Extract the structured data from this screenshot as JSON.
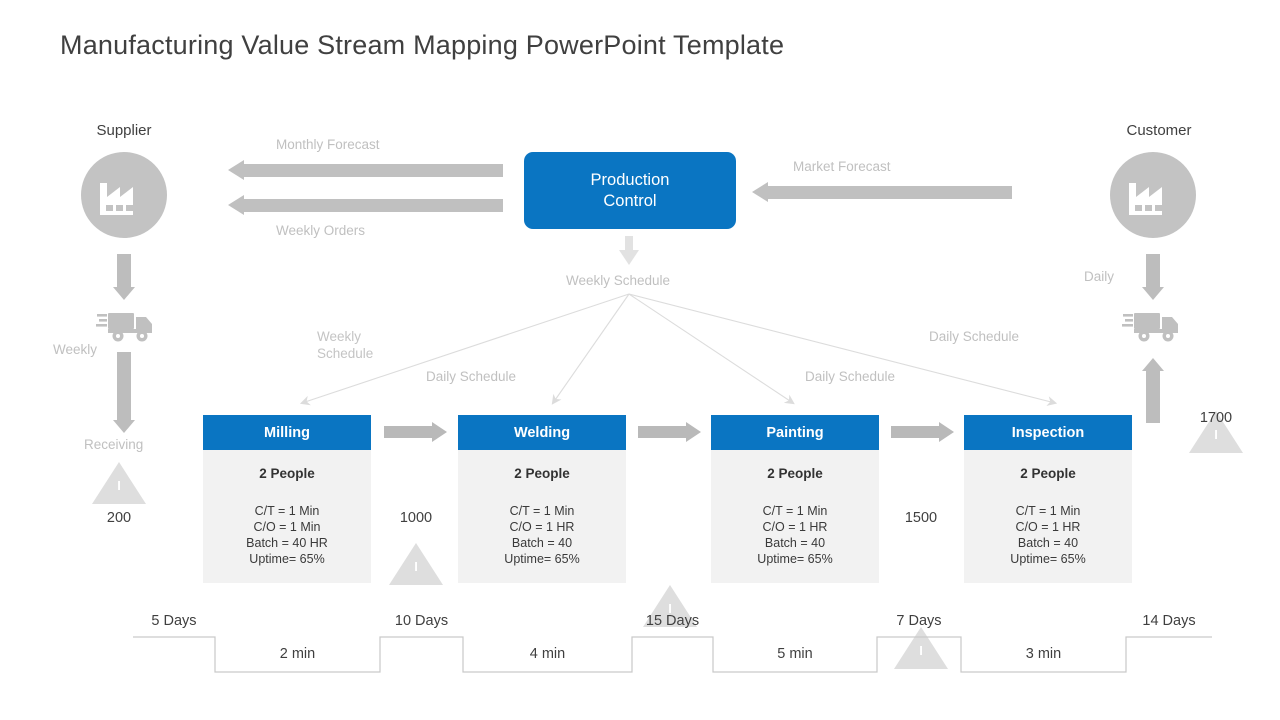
{
  "title": "Manufacturing Value Stream Mapping PowerPoint Template",
  "supplier": {
    "label": "Supplier",
    "icon": "factory-icon",
    "shipping_icon": "truck-icon",
    "frequency": "Weekly",
    "receiving": "Receiving",
    "inventory": {
      "letter": "I",
      "value": "200"
    }
  },
  "customer": {
    "label": "Customer",
    "icon": "factory-icon",
    "shipping_icon": "truck-icon",
    "frequency": "Daily",
    "inventory": {
      "letter": "I",
      "value": "1700"
    }
  },
  "production_control": {
    "line1": "Production",
    "line2": "Control"
  },
  "information_flows": {
    "monthly_forecast": "Monthly Forecast",
    "weekly_orders": "Weekly Orders",
    "market_forecast": "Market Forecast",
    "weekly_schedule": "Weekly Schedule",
    "schedule_1_line1": "Weekly",
    "schedule_1_line2": "Schedule",
    "schedule_2": "Daily  Schedule",
    "schedule_3": "Daily  Schedule",
    "schedule_4": "Daily  Schedule"
  },
  "processes": [
    {
      "name": "Milling",
      "people": "2 People",
      "ct": "C/T = 1 Min",
      "co": "C/O = 1 Min",
      "batch": "Batch = 40 HR",
      "uptime": "Uptime=  65%"
    },
    {
      "name": "Welding",
      "people": "2 People",
      "ct": "C/T = 1 Min",
      "co": "C/O = 1 HR",
      "batch": "Batch = 40",
      "uptime": "Uptime=  65%"
    },
    {
      "name": "Painting",
      "people": "2 People",
      "ct": "C/T = 1 Min",
      "co": "C/O = 1 HR",
      "batch": "Batch = 40",
      "uptime": "Uptime=  65%"
    },
    {
      "name": "Inspection",
      "people": "2 People",
      "ct": "C/T = 1 Min",
      "co": "C/O = 1 HR",
      "batch": "Batch = 40",
      "uptime": "Uptime=  65%"
    }
  ],
  "wip_inventories": [
    {
      "letter": "I",
      "value": "1000"
    },
    {
      "letter": "I",
      "value": ""
    },
    {
      "letter": "I",
      "value": "1500"
    }
  ],
  "timeline": {
    "lead_times": [
      "5 Days",
      "10 Days",
      "15 Days",
      "7 Days",
      "14 Days"
    ],
    "process_times": [
      "2 min",
      "4 min",
      "5 min",
      "3 min"
    ]
  },
  "colors": {
    "accent_blue": "#0a75c2",
    "gray_arrow": "#c0c0c0",
    "box_body": "#f2f2f2",
    "triangle": "#dedede",
    "title_text": "#404040"
  }
}
